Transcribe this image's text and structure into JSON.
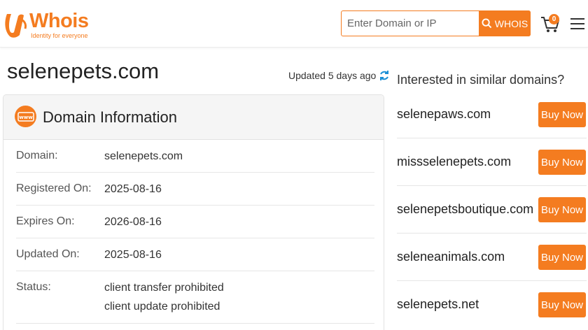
{
  "brand": {
    "name": "Whois",
    "tagline": "Identity for everyone",
    "accent_color": "#f47c20"
  },
  "search": {
    "placeholder": "Enter Domain or IP",
    "button_label": "WHOIS",
    "button_icon": "search-icon"
  },
  "cart": {
    "icon": "cart-icon",
    "count": "0"
  },
  "menu": {
    "icon": "hamburger-menu-icon"
  },
  "main": {
    "domain_title": "selenepets.com",
    "updated_text": "Updated 5 days ago",
    "refresh_icon": "refresh-icon"
  },
  "domain_info": {
    "title": "Domain Information",
    "icon": "www-icon",
    "rows": [
      {
        "label": "Domain:",
        "value": "selenepets.com"
      },
      {
        "label": "Registered On:",
        "value": "2025-08-16"
      },
      {
        "label": "Expires On:",
        "value": "2026-08-16"
      },
      {
        "label": "Updated On:",
        "value": "2025-08-16"
      },
      {
        "label": "Status:",
        "values": [
          "client transfer prohibited",
          "client update prohibited"
        ]
      }
    ]
  },
  "similar": {
    "title": "Interested in similar domains?",
    "items": [
      {
        "domain": "selenepaws.com",
        "button": "Buy Now"
      },
      {
        "domain": "missselenepets.com",
        "button": "Buy Now"
      },
      {
        "domain": "selenepetsboutique.com",
        "button": "Buy Now"
      },
      {
        "domain": "seleneanimals.com",
        "button": "Buy Now"
      },
      {
        "domain": "selenepets.net",
        "button": "Buy Now"
      }
    ]
  }
}
